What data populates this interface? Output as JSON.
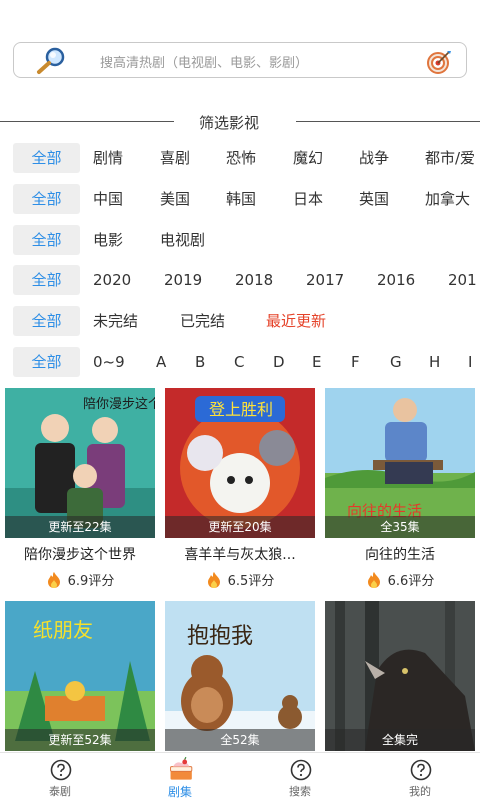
{
  "search": {
    "placeholder": "搜高清热剧（电视剧、电影、影剧）"
  },
  "section_title": "筛选影视",
  "filters": {
    "all_label": "全部",
    "genre": [
      "剧情",
      "喜剧",
      "恐怖",
      "魔幻",
      "战争",
      "都市/爱"
    ],
    "region": [
      "中国",
      "美国",
      "韩国",
      "日本",
      "英国",
      "加拿大"
    ],
    "type": [
      "电影",
      "电视剧"
    ],
    "year": [
      "2020",
      "2019",
      "2018",
      "2017",
      "2016",
      "201"
    ],
    "status": [
      "未完结",
      "已完结",
      "最近更新"
    ],
    "letter": [
      "0~9",
      "A",
      "B",
      "C",
      "D",
      "E",
      "F",
      "G",
      "H",
      "I"
    ]
  },
  "cards": [
    {
      "title": "陪你漫步这个世界",
      "overlay": "更新至22集",
      "rating": "6.9评分",
      "poster_text": "陪你漫步这个世界"
    },
    {
      "title": "喜羊羊与灰太狼...",
      "overlay": "更新至20集",
      "rating": "6.5评分",
      "poster_text": "登上胜利"
    },
    {
      "title": "向往的生活",
      "overlay": "全35集",
      "rating": "6.6评分",
      "poster_text": "向往的生活"
    },
    {
      "title": "",
      "overlay": "更新至52集",
      "rating": "",
      "poster_text": "纸朋友"
    },
    {
      "title": "",
      "overlay": "全52集",
      "rating": "",
      "poster_text": "抱抱我"
    },
    {
      "title": "",
      "overlay": "全集完",
      "rating": "",
      "poster_text": ""
    }
  ],
  "nav": [
    {
      "label": "泰剧",
      "icon": "question-circle-icon"
    },
    {
      "label": "剧集",
      "icon": "cake-icon"
    },
    {
      "label": "搜索",
      "icon": "question-circle-icon"
    },
    {
      "label": "我的",
      "icon": "question-circle-icon"
    }
  ],
  "colors": {
    "accent": "#2d8ee6",
    "highlight": "#e5432a",
    "chip_bg": "#eeeeee"
  }
}
